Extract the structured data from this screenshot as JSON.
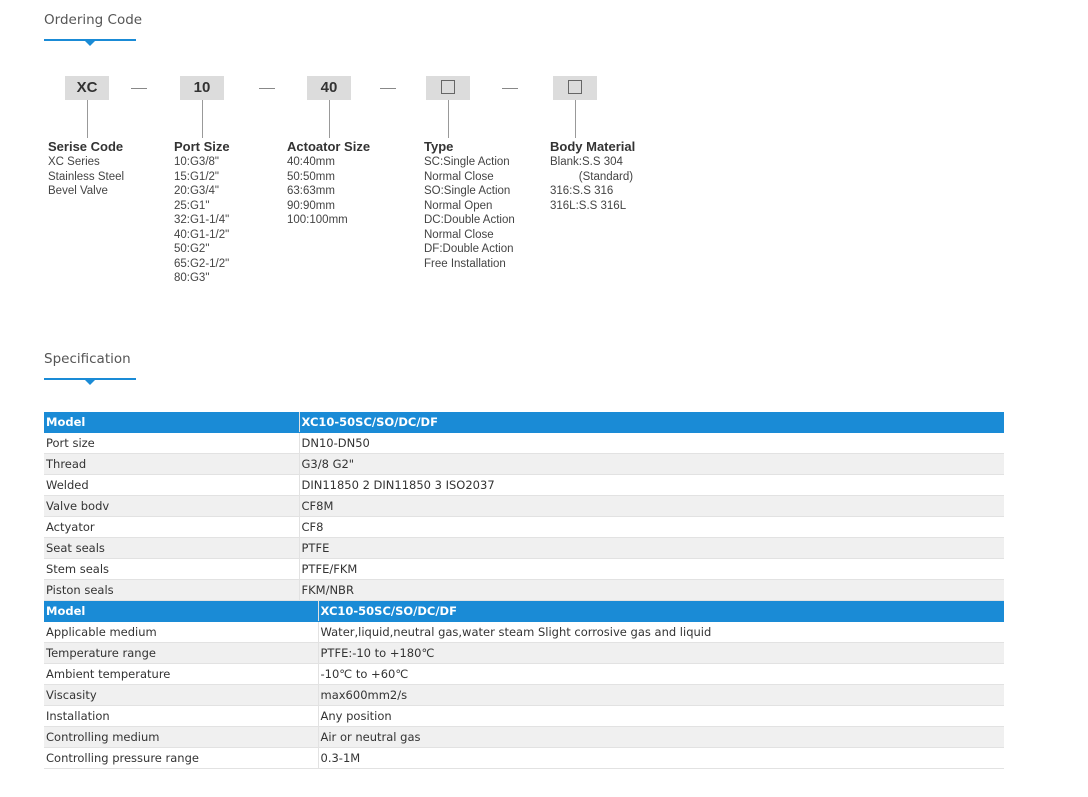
{
  "ordering": {
    "title": "Ordering Code",
    "boxes": [
      "XC",
      "10",
      "40"
    ],
    "columns": [
      {
        "heading": "Serise Code",
        "lines": [
          "XC Series",
          "Stainless Steel",
          "Bevel Valve"
        ]
      },
      {
        "heading": "Port Size",
        "lines": [
          "10:G3/8\"",
          "15:G1/2\"",
          "20:G3/4\"",
          "25:G1\"",
          "32:G1-1/4\"",
          "40:G1-1/2\"",
          "50:G2\"",
          "65:G2-1/2\"",
          "80:G3\""
        ]
      },
      {
        "heading": "Actoator Size",
        "lines": [
          "40:40mm",
          "50:50mm",
          "63:63mm",
          "90:90mm",
          "100:100mm"
        ]
      },
      {
        "heading": "Type",
        "lines": [
          "SC:Single Action",
          "Normal Close",
          "SO:Single Action",
          "Normal Open",
          "DC:Double Action",
          "Normal Close",
          "DF:Double Action",
          "Free Installation"
        ]
      },
      {
        "heading": "Body Material",
        "lines": [
          "Blank:S.S 304",
          "         (Standard)",
          "316:S.S 316",
          "316L:S.S 316L"
        ]
      }
    ]
  },
  "specification": {
    "title": "Specification",
    "table1": {
      "header": [
        "Model",
        "XC10-50SC/SO/DC/DF"
      ],
      "rows": [
        [
          "Port size",
          "DN10-DN50"
        ],
        [
          "Thread",
          "G3/8 G2\""
        ],
        [
          "Welded",
          "DIN11850 2 DIN11850 3 ISO2037"
        ],
        [
          "Valve bodv",
          "CF8M"
        ],
        [
          "Actyator",
          "CF8"
        ],
        [
          "Seat seals",
          "PTFE"
        ],
        [
          "Stem seals",
          "PTFE/FKM"
        ],
        [
          "Piston seals",
          "FKM/NBR"
        ]
      ]
    },
    "table2": {
      "header": [
        "Model",
        "XC10-50SC/SO/DC/DF"
      ],
      "rows": [
        [
          "Applicable medium",
          "Water,liquid,neutral gas,water steam Slight corrosive gas and liquid"
        ],
        [
          "Temperature range",
          "PTFE:-10 to +180℃"
        ],
        [
          "Ambient temperature",
          "-10℃ to +60℃"
        ],
        [
          "Viscasity",
          "max600mm2/s"
        ],
        [
          "Installation",
          "Any position"
        ],
        [
          "Controlling medium",
          "Air or neutral gas"
        ],
        [
          "Controlling pressure range",
          "0.3-1M"
        ]
      ]
    }
  },
  "colors": {
    "accent": "#1a8bd6",
    "box": "#dcdcdc",
    "alt_row": "#f0f0f0"
  },
  "icons": {
    "section_marker": "caret-down-icon",
    "placeholder": "empty-square-icon"
  }
}
